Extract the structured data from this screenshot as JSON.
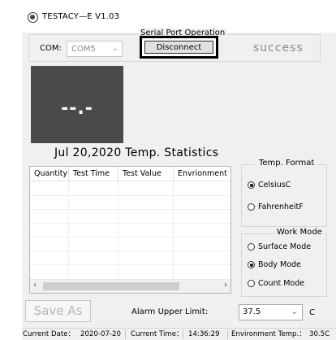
{
  "window": {
    "title": "TESTACY—E  V1.03"
  },
  "serial": {
    "group_label": "Serial Port Operation",
    "com_label": "COM:",
    "com_value": "COM5",
    "disconnect_label": "Disconnect",
    "status": "success"
  },
  "display": {
    "temperature": "--.-"
  },
  "stats": {
    "title": "Jul 20,2020 Temp. Statistics",
    "columns": [
      "Quantity",
      "Test Time",
      "Test Value",
      "Envrionment"
    ]
  },
  "temp_format": {
    "label": "Temp. Format",
    "options": [
      {
        "label": "CelsiusC",
        "selected": true
      },
      {
        "label": "FahrenheitF",
        "selected": false
      }
    ]
  },
  "work_mode": {
    "label": "Work Mode",
    "options": [
      {
        "label": "Surface Mode",
        "selected": false
      },
      {
        "label": "Body Mode",
        "selected": true
      },
      {
        "label": "Count Mode",
        "selected": false
      }
    ]
  },
  "actions": {
    "save_as": "Save As"
  },
  "alarm": {
    "label": "Alarm Upper Limit:",
    "value": "37.5",
    "unit": "C"
  },
  "statusbar": {
    "date_label": "Current Date：",
    "date_value": "2020-07-20",
    "time_label": "Current Time：",
    "time_value": "14:36:29",
    "env_label": "Environment Temp.：",
    "env_value": "30.5C"
  },
  "icons": {
    "app": "app-logo-icon",
    "dropdown": "chevron-down-icon",
    "scroll_left": "chevron-left-icon",
    "scroll_right": "chevron-right-icon"
  },
  "colors": {
    "display_bg": "#4a4a4a",
    "success_text": "#8c8c8c",
    "window_bg": "#f0f0f0"
  }
}
